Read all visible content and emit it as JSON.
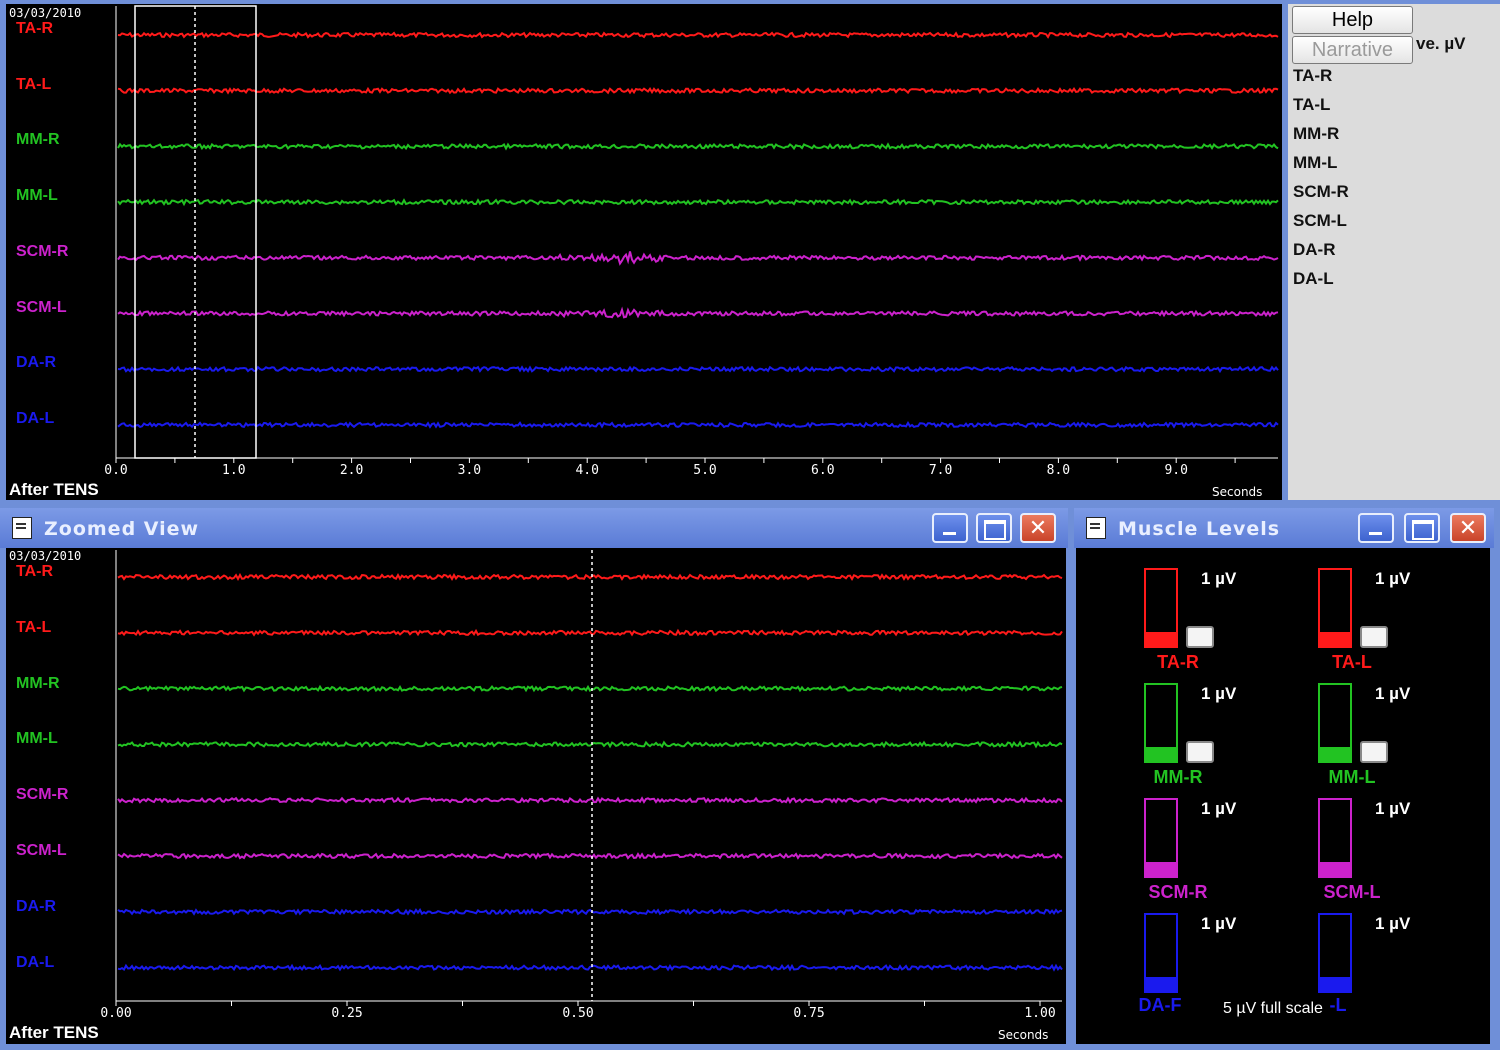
{
  "top_panel": {
    "date": "03/03/2010",
    "condition": "After TENS",
    "units": "Seconds",
    "ticks": [
      "0.0",
      "1.0",
      "2.0",
      "3.0",
      "4.0",
      "5.0",
      "6.0",
      "7.0",
      "8.0",
      "9.0"
    ]
  },
  "channels": [
    {
      "name": "TA-R",
      "color": "#ff1a1a"
    },
    {
      "name": "TA-L",
      "color": "#ff1a1a"
    },
    {
      "name": "MM-R",
      "color": "#22c322"
    },
    {
      "name": "MM-L",
      "color": "#22c322"
    },
    {
      "name": "SCM-R",
      "color": "#cc22cc"
    },
    {
      "name": "SCM-L",
      "color": "#cc22cc"
    },
    {
      "name": "DA-R",
      "color": "#1a1aee"
    },
    {
      "name": "DA-L",
      "color": "#1a1aee"
    }
  ],
  "side_panel": {
    "help_label": "Help",
    "narrative_label": "Narrative",
    "header_text": "ve. µV",
    "items": [
      "TA-R",
      "TA-L",
      "MM-R",
      "MM-L",
      "SCM-R",
      "SCM-L",
      "DA-R",
      "DA-L"
    ]
  },
  "zoomed_view": {
    "title": "Zoomed View",
    "date": "03/03/2010",
    "condition": "After TENS",
    "units": "Seconds",
    "ticks": [
      "0.00",
      "0.25",
      "0.50",
      "0.75",
      "1.00"
    ]
  },
  "muscle_levels": {
    "title": "Muscle Levels",
    "full_scale_text": "5 µV full scale",
    "meters": [
      {
        "name": "TA-R",
        "value": "1 µV",
        "color": "#ff1a1a",
        "level": 0.2,
        "checkbox": true
      },
      {
        "name": "TA-L",
        "value": "1 µV",
        "color": "#ff1a1a",
        "level": 0.2,
        "checkbox": true
      },
      {
        "name": "MM-R",
        "value": "1 µV",
        "color": "#22c322",
        "level": 0.2,
        "checkbox": true
      },
      {
        "name": "MM-L",
        "value": "1 µV",
        "color": "#22c322",
        "level": 0.2,
        "checkbox": true
      },
      {
        "name": "SCM-R",
        "value": "1 µV",
        "color": "#cc22cc",
        "level": 0.2,
        "checkbox": false
      },
      {
        "name": "SCM-L",
        "value": "1 µV",
        "color": "#cc22cc",
        "level": 0.2,
        "checkbox": false
      },
      {
        "name": "DA-F",
        "value": "1 µV",
        "color": "#1a1aee",
        "level": 0.2,
        "checkbox": false
      },
      {
        "name": "-L",
        "value": "1 µV",
        "color": "#1a1aee",
        "level": 0.2,
        "checkbox": false
      }
    ]
  }
}
